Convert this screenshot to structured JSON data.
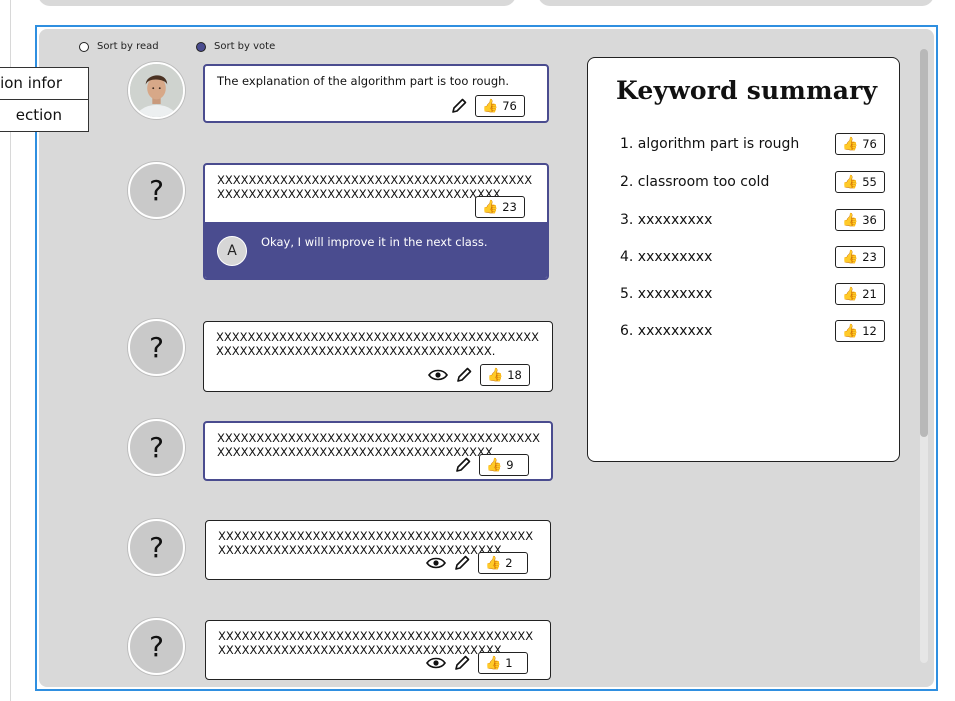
{
  "side_tabs": [
    "ion infor",
    "ection"
  ],
  "sort": {
    "by_read": "Sort by read",
    "by_vote": "Sort by vote",
    "selected": "by_vote"
  },
  "comments": [
    {
      "text": "The explanation of the algorithm part is too rough.",
      "votes": "76",
      "avatar": "photo-avatar",
      "selected": true,
      "actions": [
        "edit"
      ]
    },
    {
      "text": "XXXXXXXXXXXXXXXXXXXXXXXXXXXXXXXXXXXXXXXXXXXXXXXXXXXXXXXXXXXXXXXXXXXXXXXXXXXX",
      "votes": "23",
      "avatar": "?",
      "selected": true,
      "actions": [],
      "reply": {
        "avatar_letter": "A",
        "text": "Okay, I will improve it in the next class."
      }
    },
    {
      "text": "XXXXXXXXXXXXXXXXXXXXXXXXXXXXXXXXXXXXXXXXXXXXXXXXXXXXXXXXXXXXXXXXXXXXXXXXXXXX.",
      "votes": "18",
      "avatar": "?",
      "selected": false,
      "actions": [
        "view",
        "edit"
      ]
    },
    {
      "text": "XXXXXXXXXXXXXXXXXXXXXXXXXXXXXXXXXXXXXXXXXXXXXXXXXXXXXXXXXXXXXXXXXXXXXXXXXXXX",
      "votes": "9",
      "avatar": "?",
      "selected": true,
      "actions": [
        "edit"
      ]
    },
    {
      "text": "XXXXXXXXXXXXXXXXXXXXXXXXXXXXXXXXXXXXXXXXXXXXXXXXXXXXXXXXXXXXXXXXXXXXXXXXXXXX",
      "votes": "2",
      "avatar": "?",
      "selected": false,
      "actions": [
        "view",
        "edit"
      ]
    },
    {
      "text": "XXXXXXXXXXXXXXXXXXXXXXXXXXXXXXXXXXXXXXXXXXXXXXXXXXXXXXXXXXXXXXXXXXXXXXXXXXXX",
      "votes": "1",
      "avatar": "?",
      "selected": false,
      "actions": [
        "view",
        "edit"
      ]
    }
  ],
  "keyword_summary": {
    "title": "Keyword summary",
    "items": [
      {
        "label": "1. algorithm part is rough",
        "votes": "76"
      },
      {
        "label": "2. classroom too cold",
        "votes": "55"
      },
      {
        "label": "3. xxxxxxxxx",
        "votes": "36"
      },
      {
        "label": "4. xxxxxxxxx",
        "votes": "23"
      },
      {
        "label": "5. xxxxxxxxx",
        "votes": "21"
      },
      {
        "label": "6. xxxxxxxxx",
        "votes": "12"
      }
    ]
  },
  "icons": {
    "vote": "thumbs-up-icon",
    "edit": "pencil-icon",
    "view": "eye-icon"
  },
  "colors": {
    "accent": "#4a4c8f",
    "frame_border": "#2f8fe0",
    "panel_bg": "#d9d9d9"
  }
}
